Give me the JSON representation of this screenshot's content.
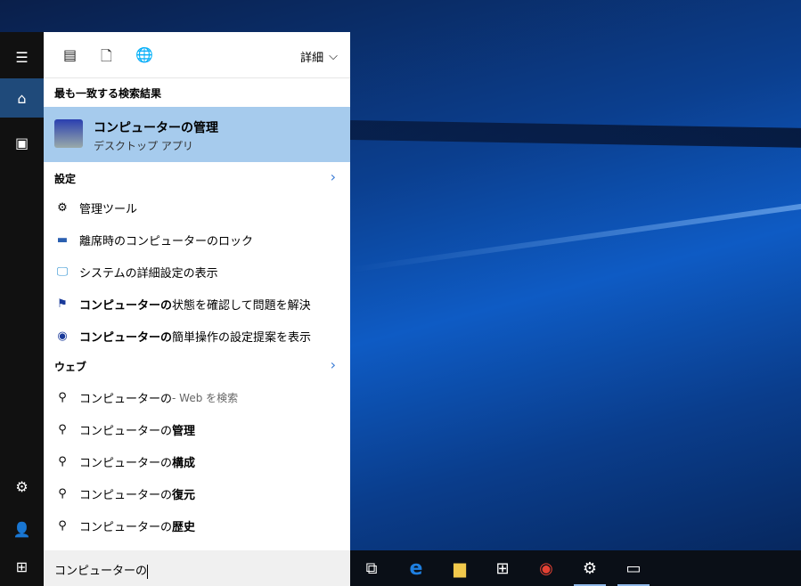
{
  "header": {
    "more_label": "詳細"
  },
  "best_match": {
    "section": "最も一致する検索結果",
    "title": "コンピューターの管理",
    "subtitle": "デスクトップ アプリ"
  },
  "settings": {
    "section": "設定",
    "items": [
      {
        "bold": "",
        "text": "管理ツール"
      },
      {
        "bold": "",
        "text": "離席時のコンピューターのロック"
      },
      {
        "bold": "",
        "text": "システムの詳細設定の表示"
      },
      {
        "bold": "コンピューターの",
        "text": "状態を確認して問題を解決"
      },
      {
        "bold": "コンピューターの",
        "text": "簡単操作の設定提案を表示"
      }
    ]
  },
  "web": {
    "section": "ウェブ",
    "first": {
      "text": "コンピューターの",
      "suffix": " - Web を検索"
    },
    "items": [
      {
        "text": "コンピューターの",
        "bold": "管理"
      },
      {
        "text": "コンピューターの",
        "bold": "構成"
      },
      {
        "text": "コンピューターの",
        "bold": "復元"
      },
      {
        "text": "コンピューターの",
        "bold": "歴史"
      }
    ]
  },
  "search": {
    "value": "コンピューターの"
  },
  "colors": {
    "highlight": "#a6cbed",
    "sidebar_active": "#1f4a7a",
    "accent": "#3a7bd5"
  }
}
